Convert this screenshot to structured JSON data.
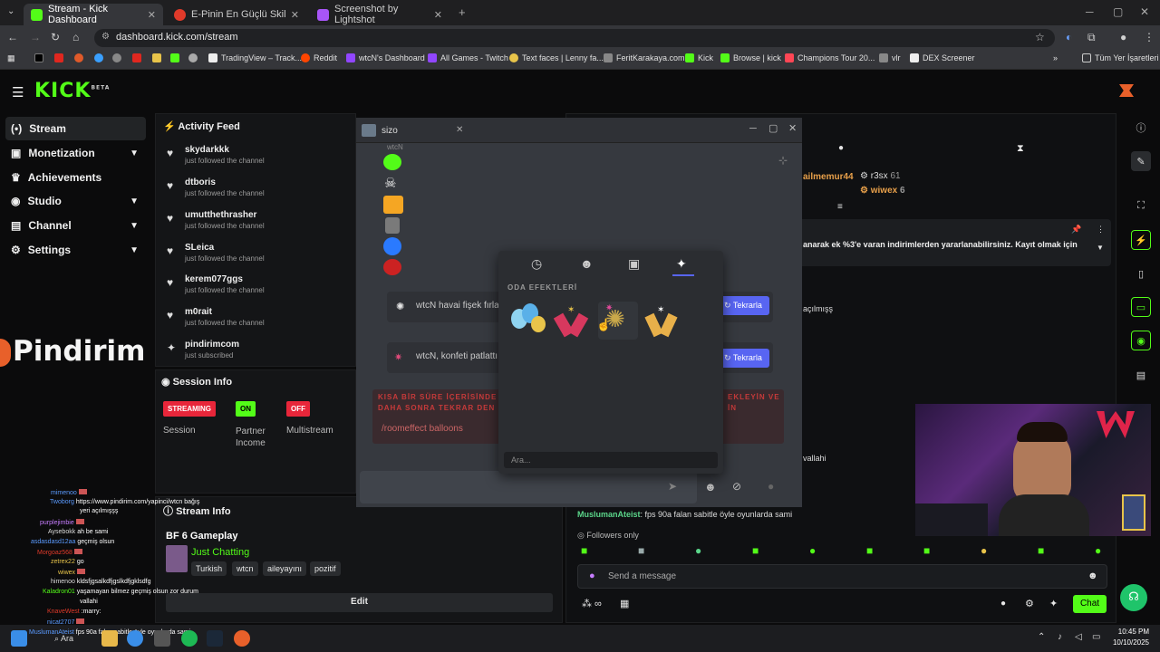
{
  "browser": {
    "tabs": [
      {
        "title": "Stream - Kick Dashboard",
        "color": "#53fc18"
      },
      {
        "title": "E-Pinin En Güçlü Skilli - Pindirin",
        "color": "#e03a2a"
      },
      {
        "title": "Screenshot by Lightshot",
        "color": "#a855f7"
      }
    ],
    "url": "dashboard.kick.com/stream",
    "bookmarks": [
      "TradingView – Track...",
      "Reddit",
      "wtcN's Dashboard",
      "All Games - Twitch",
      "Text faces | Lenny fa...",
      "FeritKarakaya.com",
      "Kick",
      "Browse | kick",
      "Champions Tour 20...",
      "vlr",
      "DEX Screener"
    ],
    "all_bookmarks": "Tüm Yer İşaretleri"
  },
  "kick": {
    "logo": "KICK",
    "logo_beta": "BETA",
    "nav": [
      {
        "label": "Stream",
        "icon": "stream-icon",
        "active": true,
        "chev": false
      },
      {
        "label": "Monetization",
        "icon": "money-icon",
        "chev": true
      },
      {
        "label": "Achievements",
        "icon": "trophy-icon",
        "chev": false
      },
      {
        "label": "Studio",
        "icon": "studio-icon",
        "chev": true
      },
      {
        "label": "Channel",
        "icon": "channel-icon",
        "chev": true
      },
      {
        "label": "Settings",
        "icon": "gear-icon",
        "chev": true
      }
    ],
    "pindirim_logo": "Pindirim",
    "activity": {
      "title": "Activity Feed",
      "items": [
        {
          "name": "skydarkkk",
          "sub": "just followed the channel"
        },
        {
          "name": "dtboris",
          "sub": "just followed the channel"
        },
        {
          "name": "umutthethrasher",
          "sub": "just followed the channel"
        },
        {
          "name": "SLeica",
          "sub": "just followed the channel"
        },
        {
          "name": "kerem077ggs",
          "sub": "just followed the channel"
        },
        {
          "name": "m0rait",
          "sub": "just followed the channel"
        },
        {
          "name": "pindirimcom",
          "sub": "just subscribed"
        }
      ]
    },
    "session": {
      "title": "Session Info",
      "badges": [
        {
          "label": "STREAMING",
          "caption": "Session",
          "color": "#e8263a"
        },
        {
          "label": "ON",
          "caption": "Partner\nIncome",
          "color": "#53fc18"
        },
        {
          "label": "OFF",
          "caption": "Multistream",
          "color": "#e8263a"
        }
      ]
    },
    "stream_info": {
      "title": "Stream Info",
      "stream_title": "BF 6 Gameplay",
      "category": "Just Chatting",
      "tags": [
        "Turkish",
        "wtcn",
        "aileyayını",
        "pozitif"
      ],
      "edit": "Edit"
    },
    "chat": {
      "top_users": [
        {
          "name": "ailmemur44",
          "color": "#e8a04a"
        },
        {
          "name": "r3sx",
          "count": "61"
        },
        {
          "name": "wiwex",
          "count": "6"
        }
      ],
      "pinned": "anarak ek %3'e varan indirimlerden yararlanabilirsiniz. Kayıt olmak için",
      "msg_acilmis": "açılmışş",
      "msg_vallahi": "vallahi",
      "last_user": "MuslumanAteist",
      "last_msg": ": fps 90a falan sabitle öyle oyunlarda sami",
      "mode": "Followers only",
      "placeholder": "Send a message",
      "chat_btn": "Chat"
    }
  },
  "overlay": {
    "title": "sizo",
    "user": "wtcN",
    "messages": [
      "wtcN havai fişek fırla",
      "wtcN, konfeti patlattı"
    ],
    "repeat": "Tekrarla",
    "warning": "KISA BİR SÜRE İÇERİSİNDE",
    "warning2": "DAHA SONRA TEKRAR DEN",
    "warning_r1": "EKLEYİN VE",
    "warning_r2": "İN",
    "command": "/roomeffect balloons",
    "picker": {
      "heading": "ODA EFEKTLERİ",
      "search": "Ara..."
    }
  },
  "side_chat": [
    {
      "u": "mimenoo",
      "c": "#5b9bff",
      "m": ""
    },
    {
      "u": "Twoborg",
      "c": "#5b9bff",
      "m": "https://www.pindirim.com/yapinci/wtcn bağış"
    },
    {
      "u": "",
      "c": "#fff",
      "m": "yeri açılmışşş"
    },
    {
      "u": "purplejimbie",
      "c": "#c77dff",
      "m": ""
    },
    {
      "u": "Aysebokk",
      "c": "#ddd",
      "m": "ah be sami"
    },
    {
      "u": "asdasdasd12aa",
      "c": "#5b9bff",
      "m": "geçmiş olsun"
    },
    {
      "u": "Morgoaz568",
      "c": "#e03a2a",
      "m": ""
    },
    {
      "u": "zetrex22",
      "c": "#e8c44a",
      "m": "go"
    },
    {
      "u": "wiwex",
      "c": "#e8c44a",
      "m": ""
    },
    {
      "u": "himenoo",
      "c": "#ddd",
      "m": "kldsfjgsalkdfjgslkdfjgklsdfg"
    },
    {
      "u": "Kaladron01",
      "c": "#53fc18",
      "m": "yaşamayan bilmez geçmiş olsun zor durum"
    },
    {
      "u": "",
      "c": "#fff",
      "m": "vallahi"
    },
    {
      "u": "KnaveWest",
      "c": "#e03a2a",
      "m": ":marry:"
    },
    {
      "u": "nicat2707",
      "c": "#5b9bff",
      "m": ""
    },
    {
      "u": "MuslumanAteist",
      "c": "#5b9bff",
      "m": "fps 90a falan sabitle öyle oyunlarda sami"
    }
  ],
  "taskbar": {
    "search": "Ara",
    "time": "10:45 PM",
    "date": "10/10/2025"
  }
}
